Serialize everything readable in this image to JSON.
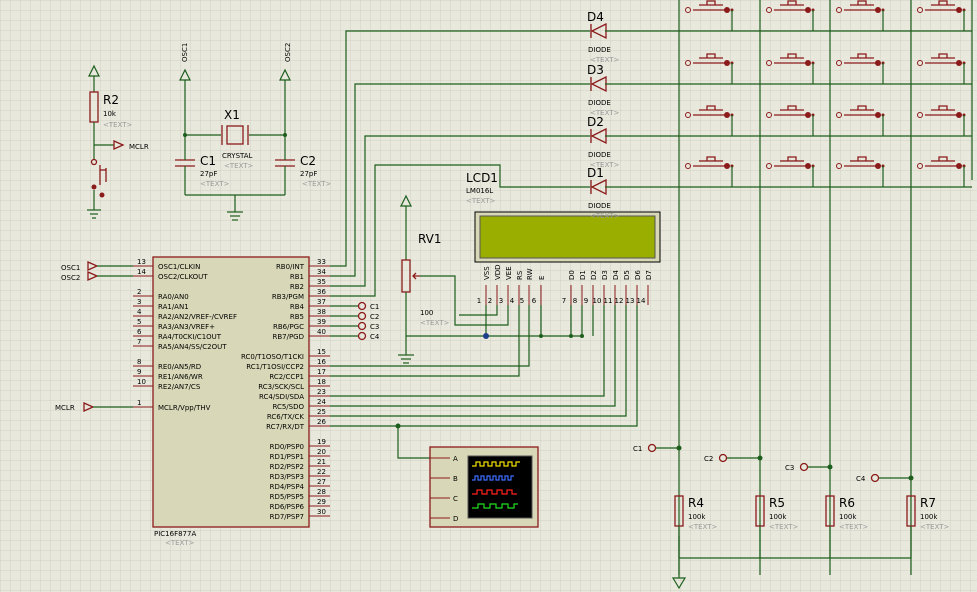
{
  "mcu": {
    "ref": "PIC16F877A",
    "ref_text": "<TEXT>",
    "left_pins": [
      {
        "num": "13",
        "name": "OSC1/CLKIN"
      },
      {
        "num": "14",
        "name": "OSC2/CLKOUT"
      },
      {
        "num": "2",
        "name": "RA0/AN0"
      },
      {
        "num": "3",
        "name": "RA1/AN1"
      },
      {
        "num": "4",
        "name": "RA2/AN2/VREF-/CVREF"
      },
      {
        "num": "5",
        "name": "RA3/AN3/VREF+"
      },
      {
        "num": "6",
        "name": "RA4/T0CKI/C1OUT"
      },
      {
        "num": "7",
        "name": "RA5/AN4/SS/C2OUT"
      },
      {
        "num": "8",
        "name": "RE0/AN5/RD"
      },
      {
        "num": "9",
        "name": "RE1/AN6/WR"
      },
      {
        "num": "10",
        "name": "RE2/AN7/CS"
      },
      {
        "num": "1",
        "name": "MCLR/Vpp/THV"
      }
    ],
    "right_pins": [
      {
        "num": "33",
        "name": "RB0/INT"
      },
      {
        "num": "34",
        "name": "RB1"
      },
      {
        "num": "35",
        "name": "RB2"
      },
      {
        "num": "36",
        "name": "RB3/PGM"
      },
      {
        "num": "37",
        "name": "RB4"
      },
      {
        "num": "38",
        "name": "RB5"
      },
      {
        "num": "39",
        "name": "RB6/PGC"
      },
      {
        "num": "40",
        "name": "RB7/PGD"
      },
      {
        "num": "15",
        "name": "RC0/T1OSO/T1CKI"
      },
      {
        "num": "16",
        "name": "RC1/T1OSI/CCP2"
      },
      {
        "num": "17",
        "name": "RC2/CCP1"
      },
      {
        "num": "18",
        "name": "RC3/SCK/SCL"
      },
      {
        "num": "23",
        "name": "RC4/SDI/SDA"
      },
      {
        "num": "24",
        "name": "RC5/SDO"
      },
      {
        "num": "25",
        "name": "RC6/TX/CK"
      },
      {
        "num": "26",
        "name": "RC7/RX/DT"
      },
      {
        "num": "19",
        "name": "RD0/PSP0"
      },
      {
        "num": "20",
        "name": "RD1/PSP1"
      },
      {
        "num": "21",
        "name": "RD2/PSP2"
      },
      {
        "num": "22",
        "name": "RD3/PSP3"
      },
      {
        "num": "27",
        "name": "RD4/PSP4"
      },
      {
        "num": "28",
        "name": "RD5/PSP5"
      },
      {
        "num": "29",
        "name": "RD6/PSP6"
      },
      {
        "num": "30",
        "name": "RD7/PSP7"
      }
    ]
  },
  "terminals": {
    "osc1_left": "OSC1",
    "osc2_left": "OSC2",
    "mclr_left": "MCLR",
    "mclr_r2": "MCLR",
    "osc1_top": "OSC1",
    "osc2_top": "OSC2",
    "c1": "C1",
    "c2": "C2",
    "c3": "C3",
    "c4": "C4"
  },
  "r2": {
    "ref": "R2",
    "value": "10k",
    "text": "<TEXT>"
  },
  "x1": {
    "ref": "X1",
    "value": "CRYSTAL",
    "text": "<TEXT>"
  },
  "c1cap": {
    "ref": "C1",
    "value": "27pF",
    "text": "<TEXT>"
  },
  "c2cap": {
    "ref": "C2",
    "value": "27pF",
    "text": "<TEXT>"
  },
  "rv1": {
    "ref": "RV1",
    "value": "100",
    "text": "<TEXT>"
  },
  "lcd": {
    "ref": "LCD1",
    "model": "LM016L",
    "text": "<TEXT>",
    "pins": [
      {
        "name": "VSS",
        "num": "1"
      },
      {
        "name": "VDD",
        "num": "2"
      },
      {
        "name": "VEE",
        "num": "3"
      },
      {
        "name": "RS",
        "num": "4"
      },
      {
        "name": "RW",
        "num": "5"
      },
      {
        "name": "E",
        "num": "6"
      },
      {
        "name": "D0",
        "num": "7"
      },
      {
        "name": "D1",
        "num": "8"
      },
      {
        "name": "D2",
        "num": "9"
      },
      {
        "name": "D3",
        "num": "10"
      },
      {
        "name": "D4",
        "num": "11"
      },
      {
        "name": "D5",
        "num": "12"
      },
      {
        "name": "D6",
        "num": "13"
      },
      {
        "name": "D7",
        "num": "14"
      }
    ]
  },
  "diodes": [
    {
      "ref": "D4",
      "value": "DIODE",
      "text": "<TEXT>"
    },
    {
      "ref": "D3",
      "value": "DIODE",
      "text": "<TEXT>"
    },
    {
      "ref": "D2",
      "value": "DIODE",
      "text": "<TEXT>"
    },
    {
      "ref": "D1",
      "value": "DIODE",
      "text": "<TEXT>"
    }
  ],
  "resistors": [
    {
      "ref": "R4",
      "value": "100k",
      "text": "<TEXT>"
    },
    {
      "ref": "R5",
      "value": "100k",
      "text": "<TEXT>"
    },
    {
      "ref": "R6",
      "value": "100k",
      "text": "<TEXT>"
    },
    {
      "ref": "R7",
      "value": "100k",
      "text": "<TEXT>"
    }
  ],
  "scope": {
    "channels": [
      "A",
      "B",
      "C",
      "D"
    ]
  },
  "colors": {
    "background": "#e8e8dd",
    "grid": "#cfcfc2",
    "wire": "#1c5e1c",
    "component": "#8b1a1a",
    "lcd_screen": "#9aae00",
    "scope_screen": "#000000"
  }
}
